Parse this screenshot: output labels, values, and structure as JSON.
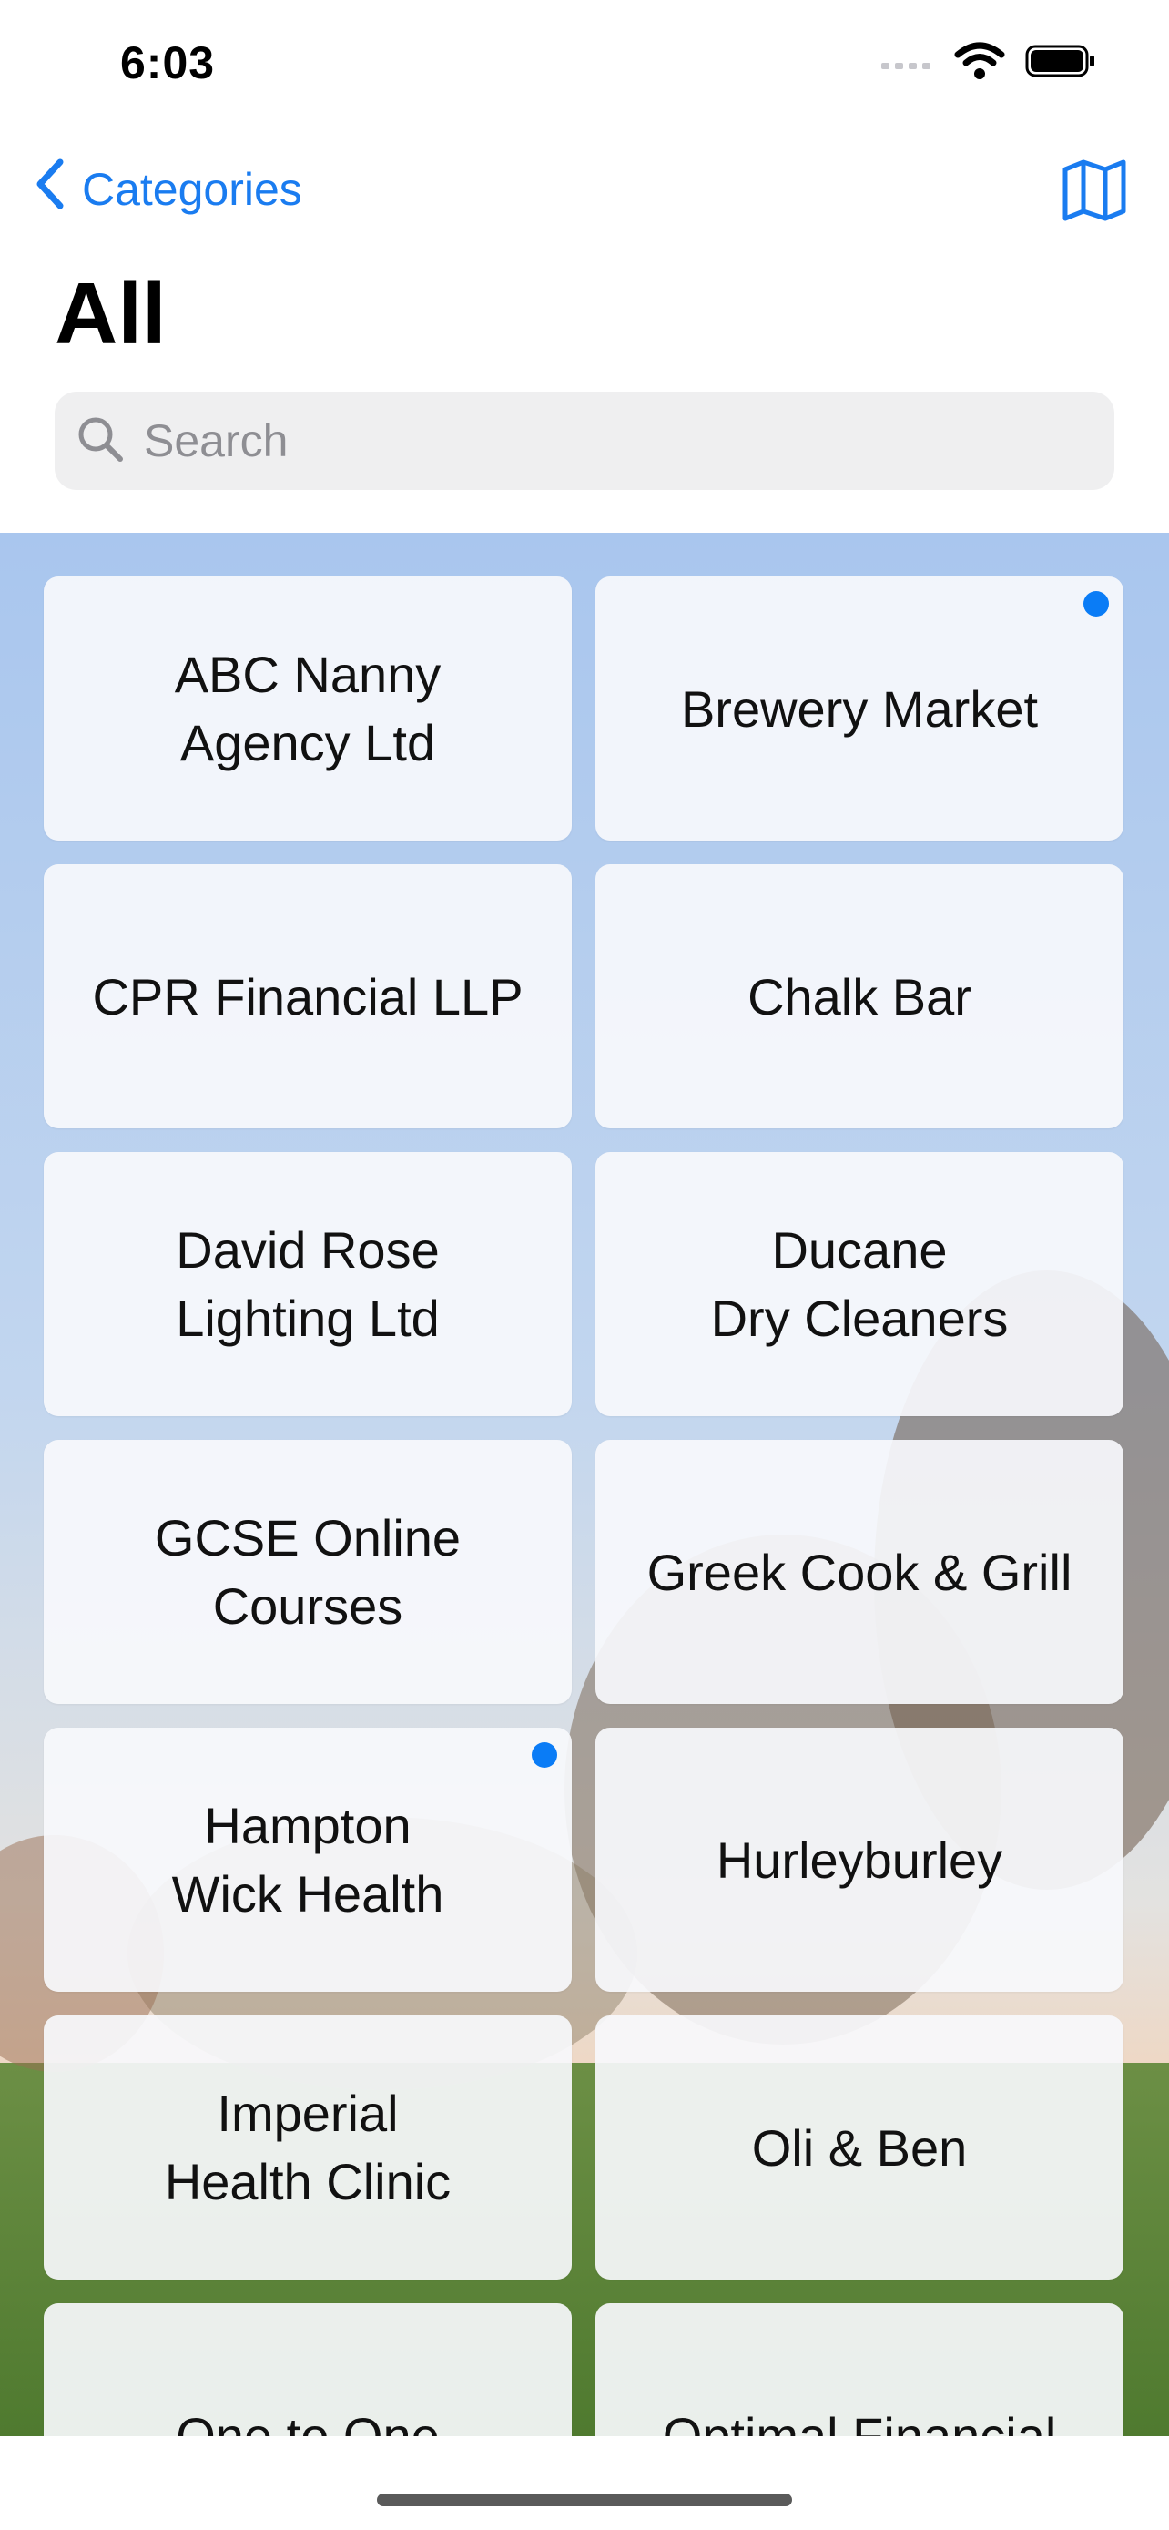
{
  "status_bar": {
    "time": "6:03"
  },
  "nav": {
    "back_label": "Categories"
  },
  "page_title": "All",
  "search": {
    "placeholder": "Search",
    "value": ""
  },
  "colors": {
    "accent": "#1a7cf0",
    "unread_dot": "#0a7cf6"
  },
  "icons": {
    "back": "chevron-left-icon",
    "map": "map-icon",
    "search": "magnifier-icon",
    "signal": "cellular-signal-icon",
    "wifi": "wifi-icon",
    "battery": "battery-icon"
  },
  "businesses": [
    {
      "name": "ABC Nanny\nAgency Ltd",
      "unread": false
    },
    {
      "name": "Brewery Market",
      "unread": true
    },
    {
      "name": "CPR Financial LLP",
      "unread": false
    },
    {
      "name": "Chalk Bar",
      "unread": false
    },
    {
      "name": "David Rose\nLighting Ltd",
      "unread": false
    },
    {
      "name": "Ducane\nDry Cleaners",
      "unread": false
    },
    {
      "name": "GCSE Online\nCourses",
      "unread": false
    },
    {
      "name": "Greek Cook & Grill",
      "unread": false
    },
    {
      "name": "Hampton\nWick Health",
      "unread": true
    },
    {
      "name": "Hurleyburley",
      "unread": false
    },
    {
      "name": "Imperial\nHealth Clinic",
      "unread": false
    },
    {
      "name": "Oli & Ben",
      "unread": false
    },
    {
      "name": "One to One",
      "unread": false
    },
    {
      "name": "Optimal Financial",
      "unread": false
    }
  ]
}
